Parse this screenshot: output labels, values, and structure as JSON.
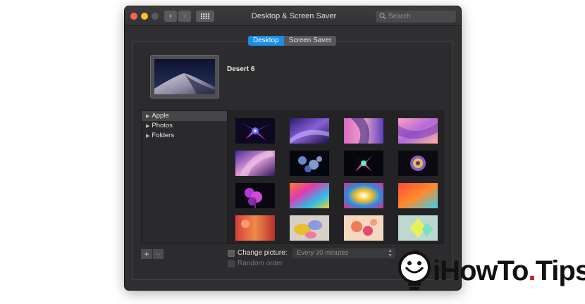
{
  "window": {
    "title": "Desktop & Screen Saver",
    "nav_back": "‹",
    "nav_forward": "›"
  },
  "search": {
    "placeholder": "Search"
  },
  "tabs": [
    {
      "label": "Desktop",
      "active": true
    },
    {
      "label": "Screen Saver",
      "active": false
    }
  ],
  "preview": {
    "name": "Desert 6"
  },
  "sources": [
    {
      "label": "Apple",
      "selected": true
    },
    {
      "label": "Photos",
      "selected": false
    },
    {
      "label": "Folders",
      "selected": false
    }
  ],
  "bottom": {
    "add_label": "+",
    "remove_label": "−",
    "change_picture_label": "Change picture:",
    "change_picture_checked": false,
    "interval_value": "Every 30 minutes",
    "random_order_label": "Random order",
    "random_order_checked": false
  },
  "watermark": {
    "text_main": "iHowTo",
    "text_dot": ".",
    "text_tail": "Tips"
  },
  "colors": {
    "accent": "#1a8ee8",
    "window_bg": "#2f2f31",
    "watermark_dot": "#d11c1c"
  },
  "icons": {
    "back": "chevron-left-icon",
    "forward": "chevron-right-icon",
    "show_all": "grid-icon",
    "search": "magnifier-icon",
    "disclosure": "triangle-right-icon"
  }
}
